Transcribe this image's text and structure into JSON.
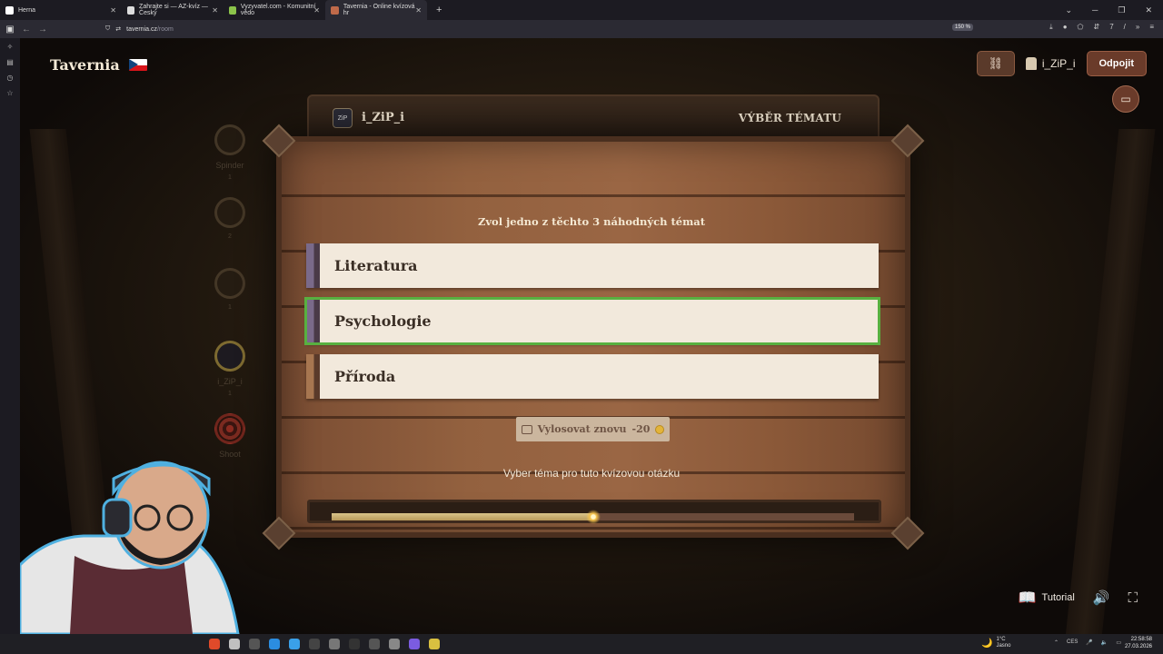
{
  "browser": {
    "tabs": [
      {
        "label": "Herna",
        "color": "#ffffff"
      },
      {
        "label": "Zahrajte si — AZ-kvíz — Český",
        "color": "#e8e8e8"
      },
      {
        "label": "Vyzyvatel.com - Komunitní vědo",
        "color": "#8bc34a"
      },
      {
        "label": "Tavernia - Online kvízová hr",
        "color": "#c06a4a",
        "active": true
      }
    ],
    "url_host": "tavernia.cz",
    "url_path": "/room",
    "zoom": "150 %"
  },
  "header": {
    "brand": "Tavernia",
    "user": "i_ZiP_i",
    "leave_label": "Odpojit"
  },
  "players": [
    {
      "name": "Spinder",
      "score": "1"
    },
    {
      "name": "",
      "score": "2"
    },
    {
      "name": "",
      "score": "1"
    },
    {
      "name": "i_ZiP_i",
      "score": "1"
    },
    {
      "name": "Shoot",
      "score": ""
    }
  ],
  "board": {
    "player_name": "i_ZiP_i",
    "avatar_text": "ZiP",
    "phase": "VÝBĚR TÉMATU",
    "prompt": "Zvol jedno z těchto 3 náhodných témat",
    "topics": [
      {
        "label": "Literatura",
        "selected": false
      },
      {
        "label": "Psychologie",
        "selected": true
      },
      {
        "label": "Příroda",
        "selected": false
      }
    ],
    "reroll_label": "Vylosovat znovu",
    "reroll_cost": "-20",
    "hint": "Vyber téma pro tuto kvízovou otázku",
    "timer_progress": 0.5
  },
  "footer": {
    "tutorial_label": "Tutorial"
  },
  "taskbar": {
    "temperature": "1°C",
    "weather": "Jasno",
    "lang": "CES",
    "time": "22:58:58",
    "date": "27.03.2026"
  }
}
